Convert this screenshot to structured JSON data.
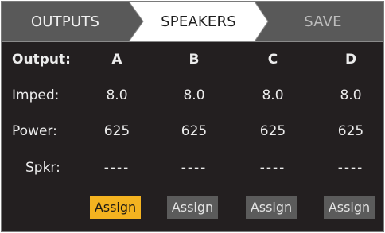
{
  "tabs": {
    "outputs": "OUTPUTS",
    "speakers": "SPEAKERS",
    "save": "SAVE"
  },
  "header": {
    "label": "Output:",
    "columns": [
      "A",
      "B",
      "C",
      "D"
    ]
  },
  "rows": {
    "imped": {
      "label": "Imped:",
      "values": [
        "8.0",
        "8.0",
        "8.0",
        "8.0"
      ]
    },
    "power": {
      "label": "Power:",
      "values": [
        "625",
        "625",
        "625",
        "625"
      ]
    },
    "spkr": {
      "label": "Spkr:",
      "values": [
        "----",
        "----",
        "----",
        "----"
      ]
    }
  },
  "assign": {
    "labels": [
      "Assign",
      "Assign",
      "Assign",
      "Assign"
    ],
    "active_index": 0
  },
  "colors": {
    "background": "#231f20",
    "tab_inactive": "#595959",
    "tab_active": "#ffffff",
    "assign_active": "#f4b320",
    "assign_inactive": "#5b5b5b"
  }
}
